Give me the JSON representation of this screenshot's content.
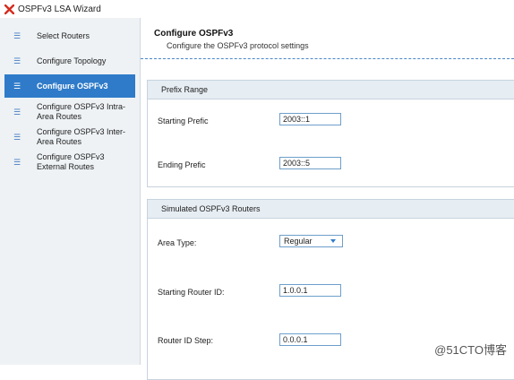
{
  "window": {
    "title": "OSPFv3 LSA Wizard"
  },
  "sidebar": {
    "items": [
      {
        "label": "Select Routers",
        "icon": "list-icon"
      },
      {
        "label": "Configure Topology",
        "icon": "list-icon"
      },
      {
        "label": "Configure OSPFv3",
        "icon": "list-icon",
        "active": true
      },
      {
        "label": "Configure OSPFv3 Intra-Area Routes",
        "icon": "list-icon"
      },
      {
        "label": "Configure OSPFv3 Inter-Area Routes",
        "icon": "list-icon"
      },
      {
        "label": "Configure OSPFv3 External Routes",
        "icon": "list-icon"
      }
    ]
  },
  "main": {
    "title": "Configure OSPFv3",
    "subtitle": "Configure the OSPFv3 protocol settings",
    "prefix_range": {
      "header": "Prefix Range",
      "starting_prefix_label": "Starting Prefic",
      "starting_prefix_value": "2003::1",
      "ending_prefix_label": "Ending Prefic",
      "ending_prefix_value": "2003::5"
    },
    "simulated_routers": {
      "header": "Simulated OSPFv3 Routers",
      "area_type_label": "Area Type:",
      "area_type_value": "Regular",
      "starting_router_id_label": "Starting Router ID:",
      "starting_router_id_value": "1.0.0.1",
      "router_id_step_label": "Router ID Step:",
      "router_id_step_value": "0.0.0.1"
    }
  },
  "watermark": "@51CTO博客",
  "colors": {
    "accent": "#2f7bc9",
    "sidebar_bg": "#eef2f5",
    "panel_header_bg": "#e6edf3",
    "logo_red": "#d52b1e"
  }
}
